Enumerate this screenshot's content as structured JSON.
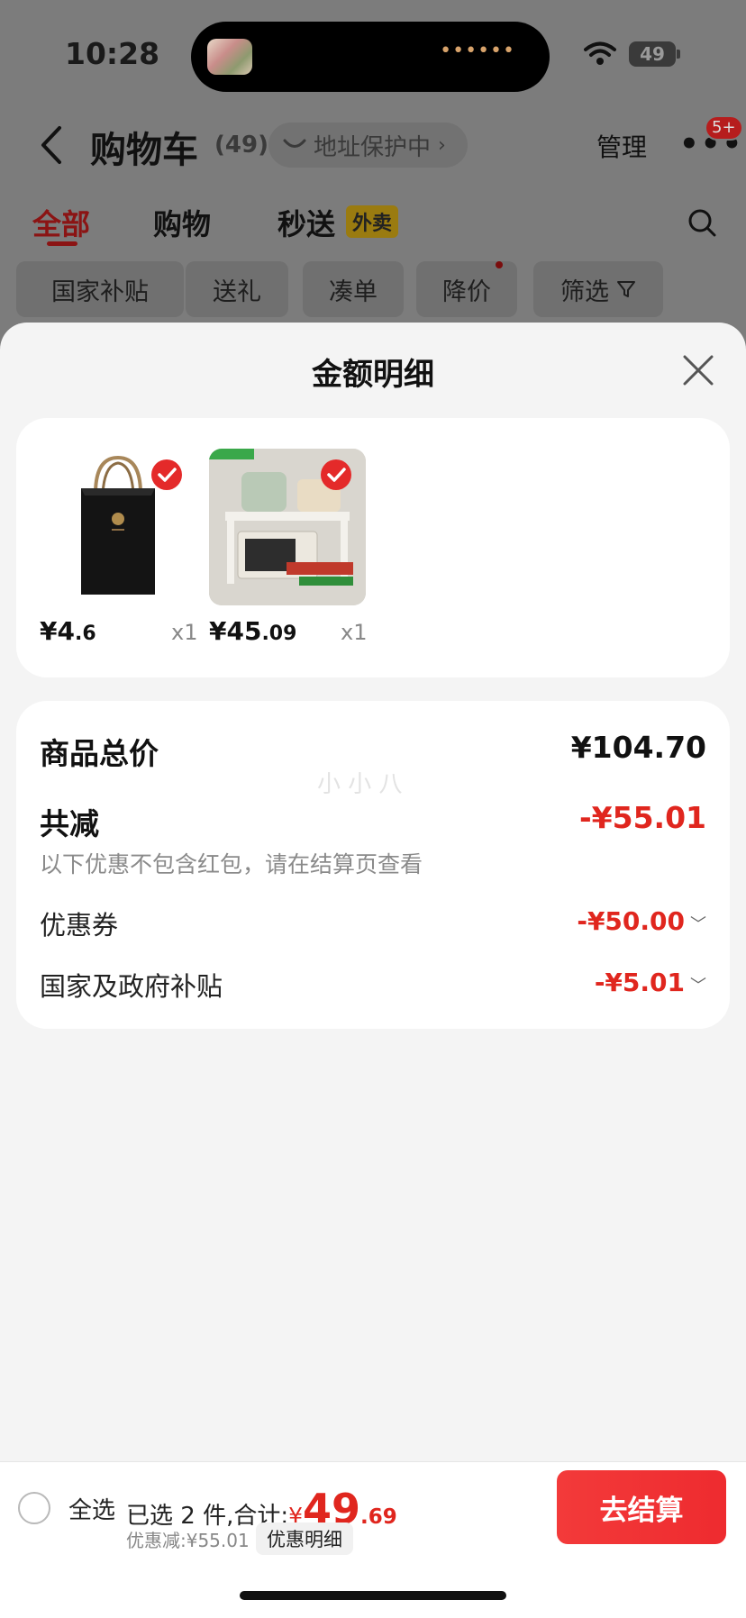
{
  "status": {
    "time": "10:28",
    "battery": "49",
    "island_dots": "••••••"
  },
  "header": {
    "title": "购物车",
    "count": "(49)",
    "address": "地址保护中",
    "manage": "管理",
    "more": "•••",
    "badge": "5+"
  },
  "tabs": [
    {
      "label": "全部"
    },
    {
      "label": "购物"
    },
    {
      "label": "秒送",
      "badge": "外卖"
    }
  ],
  "filters": [
    "国家补贴",
    "送礼",
    "凑单",
    "降价",
    "筛选"
  ],
  "sheet": {
    "title": "金额明细",
    "products": [
      {
        "price_int": "¥4",
        "price_dec": ".6",
        "qty": "x1"
      },
      {
        "price_int": "¥45",
        "price_dec": ".09",
        "qty": "x1"
      }
    ],
    "summary": {
      "total_label": "商品总价",
      "total_value": "¥104.70",
      "discount_label": "共减",
      "discount_value": "-¥55.01",
      "note": "以下优惠不包含红包，请在结算页查看",
      "coupon_label": "优惠券",
      "coupon_value": "-¥50.00",
      "subsidy_label": "国家及政府补贴",
      "subsidy_value": "-¥5.01"
    },
    "watermark": "小 小 八"
  },
  "bottom": {
    "select_all": "全选",
    "selected_text": "已选 2 件,合计:",
    "yuan": "¥",
    "amount_int": "49",
    "amount_dec": ".69",
    "saved": "优惠减:¥55.01",
    "detail": "优惠明细",
    "checkout": "去结算"
  },
  "colors": {
    "accent": "#e0261e",
    "checkout": "#f33a3a",
    "overlay_bg": "#7c7c7c"
  }
}
